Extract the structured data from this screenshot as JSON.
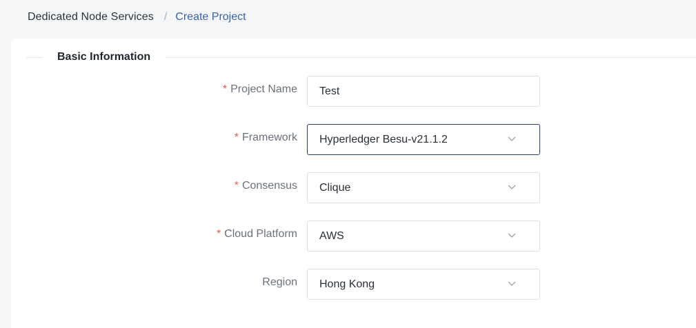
{
  "breadcrumb": {
    "root": "Dedicated Node Services",
    "separator": "/",
    "current": "Create Project"
  },
  "section": {
    "title": "Basic Information"
  },
  "form": {
    "project_name": {
      "label": "Project Name",
      "required_mark": "*",
      "value": "Test"
    },
    "framework": {
      "label": "Framework",
      "required_mark": "*",
      "value": "Hyperledger Besu-v21.1.2",
      "icon": "chevron-down-icon"
    },
    "consensus": {
      "label": "Consensus",
      "required_mark": "*",
      "value": "Clique",
      "icon": "chevron-down-icon"
    },
    "cloud_platform": {
      "label": "Cloud Platform",
      "required_mark": "*",
      "value": "AWS",
      "icon": "chevron-down-icon"
    },
    "region": {
      "label": "Region",
      "value": "Hong Kong",
      "icon": "chevron-down-icon"
    }
  },
  "colors": {
    "accent_link": "#3a63a6",
    "required": "#e3604e",
    "focus_border": "#2a3e6b"
  }
}
